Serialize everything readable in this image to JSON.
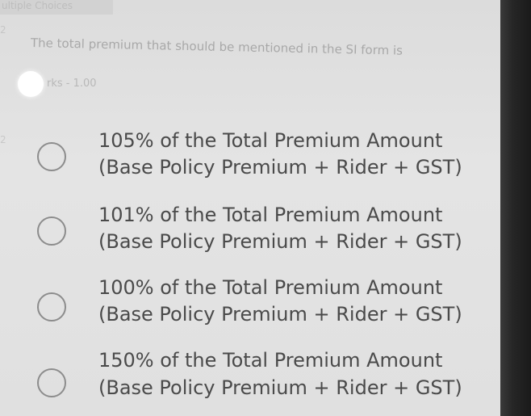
{
  "header": {
    "section_label": "ultiple Choices",
    "question_number": "2"
  },
  "question": {
    "text": "The total premium that should be mentioned in the SI form is",
    "marks": "rks - 1.00",
    "side_number": "2"
  },
  "options": [
    {
      "line1": "105% of the Total Premium Amount",
      "line2": "(Base Policy Premium + Rider + GST)"
    },
    {
      "line1": "101% of the Total Premium Amount",
      "line2": "(Base Policy Premium + Rider + GST)"
    },
    {
      "line1": "100% of the Total Premium Amount",
      "line2": "(Base Policy Premium + Rider + GST)"
    },
    {
      "line1": "150% of the Total Premium Amount",
      "line2": "(Base Policy Premium + Rider + GST)"
    }
  ]
}
